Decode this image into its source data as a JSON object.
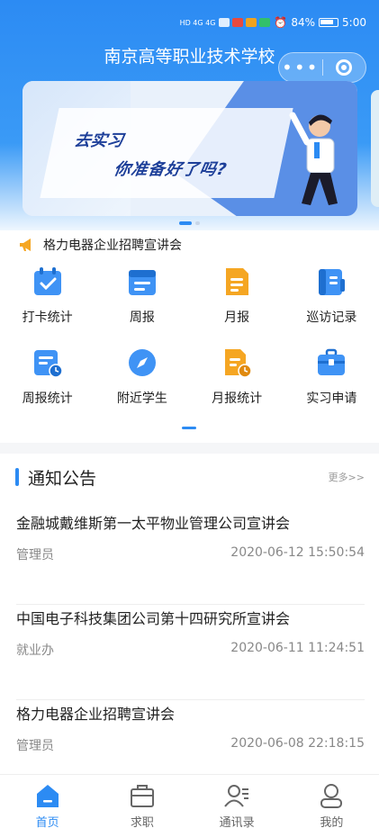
{
  "status_bar": {
    "network": "HD 4G 4G",
    "battery": "84%",
    "time": "5:00"
  },
  "app": {
    "title": "南京高等职业技术学校",
    "menu_icon": "more-dots-icon",
    "close_icon": "close-circle-icon"
  },
  "banner": {
    "line1": "去实习",
    "line2": "你准备好了吗?"
  },
  "notice_line": {
    "icon": "megaphone-icon",
    "text": "格力电器企业招聘宣讲会"
  },
  "grid": [
    {
      "label": "打卡统计",
      "icon": "checkin-icon"
    },
    {
      "label": "周报",
      "icon": "weekly-report-icon"
    },
    {
      "label": "月报",
      "icon": "monthly-report-icon"
    },
    {
      "label": "巡访记录",
      "icon": "visit-record-icon"
    },
    {
      "label": "周报统计",
      "icon": "weekly-stats-icon"
    },
    {
      "label": "附近学生",
      "icon": "compass-icon"
    },
    {
      "label": "月报统计",
      "icon": "monthly-stats-icon"
    },
    {
      "label": "实习申请",
      "icon": "briefcase-icon"
    }
  ],
  "announcements": {
    "title": "通知公告",
    "more": "更多>>",
    "items": [
      {
        "title": "金融城戴维斯第一太平物业管理公司宣讲会",
        "author": "管理员",
        "time": "2020-06-12 15:50:54"
      },
      {
        "title": "中国电子科技集团公司第十四研究所宣讲会",
        "author": "就业办",
        "time": "2020-06-11 11:24:51"
      },
      {
        "title": "格力电器企业招聘宣讲会",
        "author": "管理员",
        "time": "2020-06-08 22:18:15"
      }
    ]
  },
  "tabs": [
    {
      "label": "首页",
      "icon": "home-icon",
      "active": true
    },
    {
      "label": "求职",
      "icon": "briefcase-outline-icon",
      "active": false
    },
    {
      "label": "通讯录",
      "icon": "contacts-icon",
      "active": false
    },
    {
      "label": "我的",
      "icon": "user-icon",
      "active": false
    }
  ],
  "colors": {
    "primary": "#2c8bf3",
    "orange": "#f5a623"
  }
}
